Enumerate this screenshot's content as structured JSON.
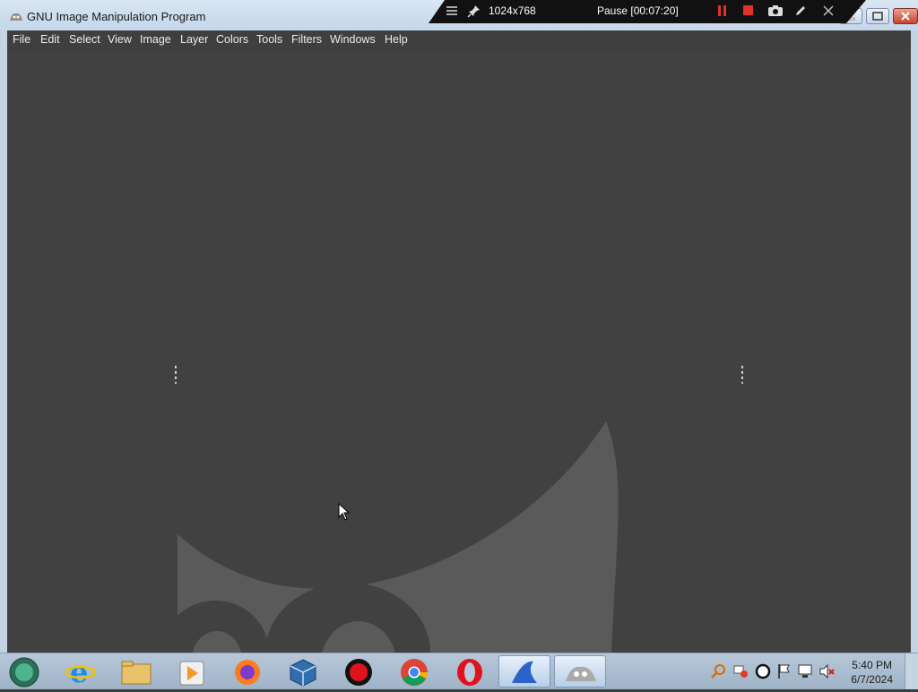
{
  "window": {
    "title": "GNU Image Manipulation Program"
  },
  "recorder": {
    "resolution": "1024x768",
    "status": "Pause [00:07:20]"
  },
  "menu": {
    "items": [
      "File",
      "Edit",
      "Select",
      "View",
      "Image",
      "Layer",
      "Colors",
      "Tools",
      "Filters",
      "Windows",
      "Help"
    ]
  },
  "taskbar": {
    "apps": [
      "start-orb-icon",
      "internet-explorer-icon",
      "file-explorer-icon",
      "media-player-icon",
      "firefox-icon",
      "virtualbox-icon",
      "screen-recorder-icon",
      "chrome-icon",
      "opera-icon",
      "app-shark-icon",
      "gimp-icon"
    ],
    "tray_icons": [
      "search-tray-icon",
      "network-tray-icon",
      "record-tray-icon",
      "flag-tray-icon",
      "display-tray-icon",
      "volume-muted-icon"
    ],
    "clock": {
      "time": "5:40 PM",
      "date": "6/7/2024"
    }
  },
  "colors": {
    "canvas": "#414141",
    "menubar": "#3f3f3f",
    "recorder_red": "#e0312b"
  }
}
